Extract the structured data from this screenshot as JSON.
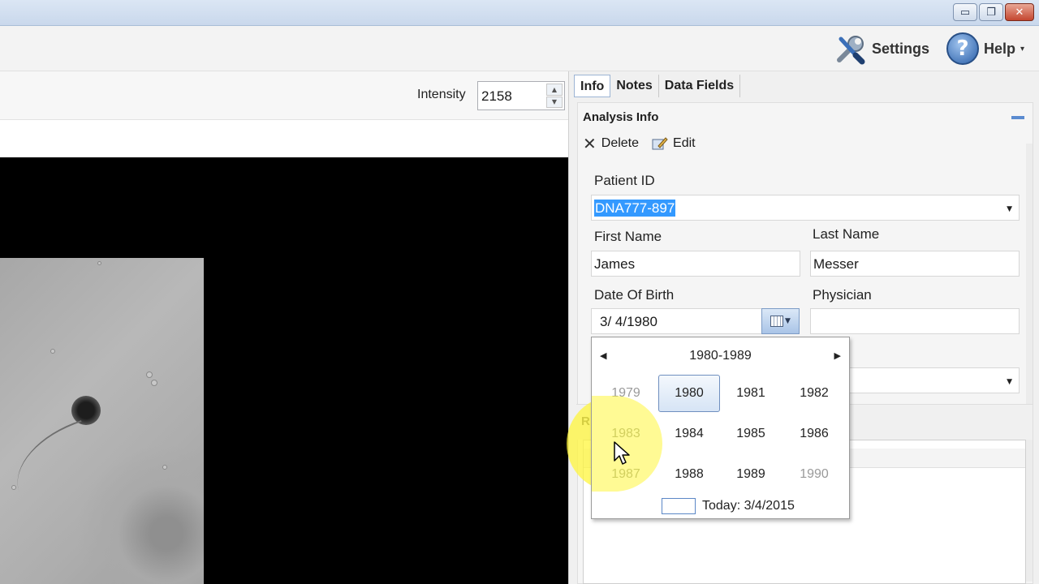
{
  "window": {
    "minimize_icon": "minimize-icon",
    "restore_icon": "restore-icon",
    "close_icon": "close-icon",
    "minimize_glyph": "▭",
    "restore_glyph": "❐",
    "close_glyph": "✕"
  },
  "ribbon": {
    "settings_label": "Settings",
    "help_label": "Help",
    "help_glyph": "?"
  },
  "viewer": {
    "intensity_label": "Intensity",
    "intensity_value": "2158"
  },
  "panel": {
    "tabs": [
      {
        "label": "Info"
      },
      {
        "label": "Notes"
      },
      {
        "label": "Data Fields"
      }
    ],
    "section_title": "Analysis Info",
    "delete_label": "Delete",
    "edit_label": "Edit",
    "patient_id_label": "Patient ID",
    "patient_id_value": "DNA777-897",
    "first_name_label": "First Name",
    "first_name_value": "James",
    "last_name_label": "Last Name",
    "last_name_value": "Messer",
    "dob_label": "Date Of Birth",
    "dob_value": "3/  4/1980",
    "physician_label": "Physician",
    "physician_value": "",
    "r_label": "R"
  },
  "calendar": {
    "decade": "1980-1989",
    "years": [
      "1979",
      "1980",
      "1981",
      "1982",
      "1983",
      "1984",
      "1985",
      "1986",
      "1987",
      "1988",
      "1989",
      "1990"
    ],
    "selected_year": "1980",
    "today_text": "Today: 3/4/2015"
  },
  "colors": {
    "accent": "#3399ff",
    "highlight": "#fff53c"
  }
}
